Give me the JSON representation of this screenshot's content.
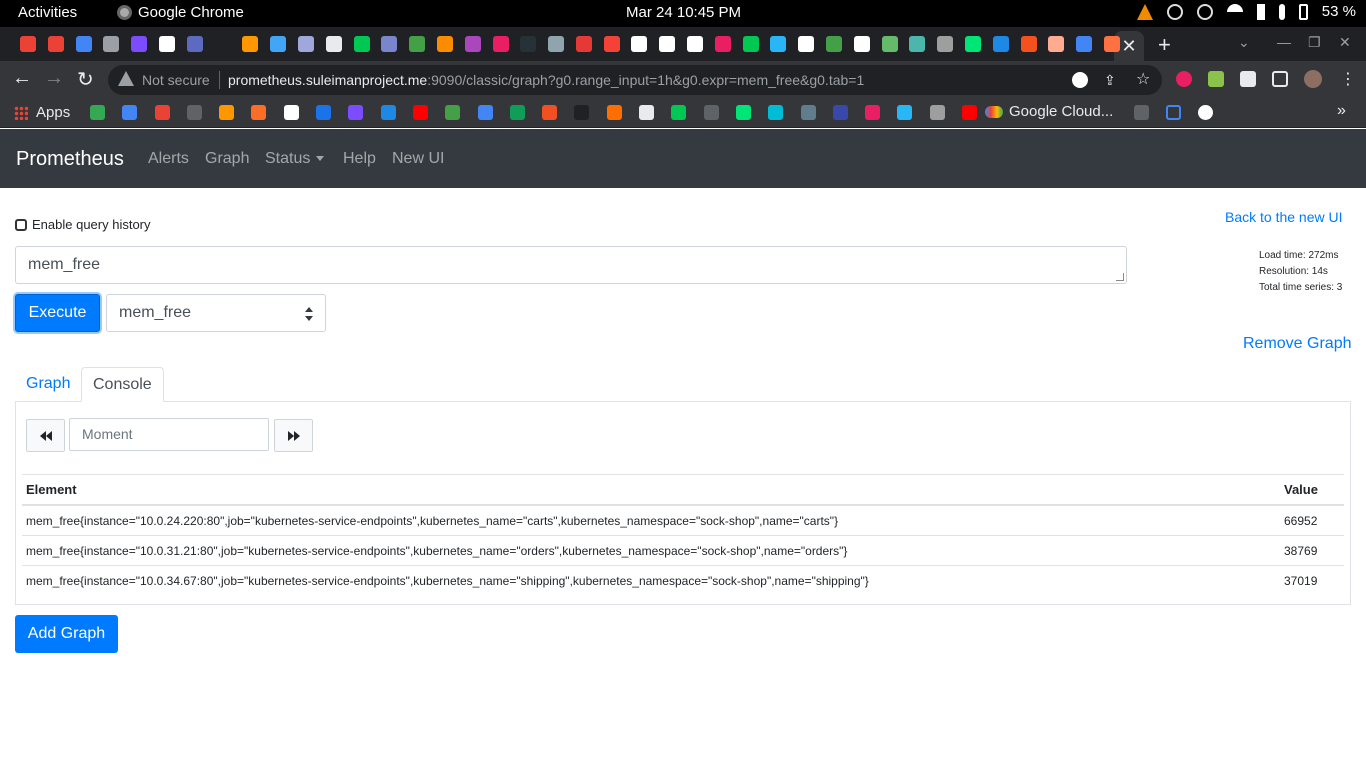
{
  "system": {
    "activities": "Activities",
    "app_name": "Google Chrome",
    "clock": "Mar 24  10:45 PM",
    "battery": "53 %"
  },
  "browser": {
    "security_label": "Not secure",
    "url_host": "prometheus.suleimanproject.me",
    "url_rest": ":9090/classic/graph?g0.range_input=1h&g0.expr=mem_free&g0.tab=1",
    "bookmarks": {
      "apps_label": "Apps",
      "cloud_label": "Google Cloud..."
    },
    "tab_icon_colors": [
      "#ea4335",
      "#ea4335",
      "#4285f4",
      "#9aa0a6",
      "#7c4dff",
      "#ffffff",
      "#5c6bc0",
      "#202124",
      "#ff9800",
      "#42a5f5",
      "#9fa8da",
      "#e8eaed",
      "#00c853",
      "#7986cb",
      "#43a047",
      "#fb8c00",
      "#ab47bc",
      "#e91e63",
      "#263238",
      "#90a4ae",
      "#e53935",
      "#f44336",
      "#ffffff",
      "#ffffff",
      "#ffffff",
      "#e91e63",
      "#00c853",
      "#29b6f6",
      "#ffffff",
      "#43a047",
      "#ffffff",
      "#66bb6a",
      "#4db6ac",
      "#9e9e9e",
      "#00e676",
      "#1e88e5",
      "#f4511e",
      "#ffab91",
      "#4285f4",
      "#ff7043"
    ]
  },
  "prometheus": {
    "brand": "Prometheus",
    "nav": {
      "alerts": "Alerts",
      "graph": "Graph",
      "status": "Status",
      "help": "Help",
      "new_ui": "New UI"
    },
    "query_history_label": "Enable query history",
    "back_to_new_ui": "Back to the new UI",
    "stats": {
      "load_time": "Load time: 272ms",
      "resolution": "Resolution: 14s",
      "total_series": "Total time series: 3"
    },
    "expression": "mem_free",
    "execute_label": "Execute",
    "metric_select": "mem_free",
    "remove_graph": "Remove Graph",
    "tabs": {
      "graph": "Graph",
      "console": "Console"
    },
    "moment_placeholder": "Moment",
    "table": {
      "headers": [
        "Element",
        "Value"
      ],
      "rows": [
        {
          "element": "mem_free{instance=\"10.0.24.220:80\",job=\"kubernetes-service-endpoints\",kubernetes_name=\"carts\",kubernetes_namespace=\"sock-shop\",name=\"carts\"}",
          "value": "66952"
        },
        {
          "element": "mem_free{instance=\"10.0.31.21:80\",job=\"kubernetes-service-endpoints\",kubernetes_name=\"orders\",kubernetes_namespace=\"sock-shop\",name=\"orders\"}",
          "value": "38769"
        },
        {
          "element": "mem_free{instance=\"10.0.34.67:80\",job=\"kubernetes-service-endpoints\",kubernetes_name=\"shipping\",kubernetes_namespace=\"sock-shop\",name=\"shipping\"}",
          "value": "37019"
        }
      ]
    },
    "add_graph": "Add Graph"
  },
  "colors": {
    "primary": "#007bff",
    "navbar": "#343a40",
    "chrome_dark": "#202124",
    "chrome_toolbar": "#35363a"
  }
}
